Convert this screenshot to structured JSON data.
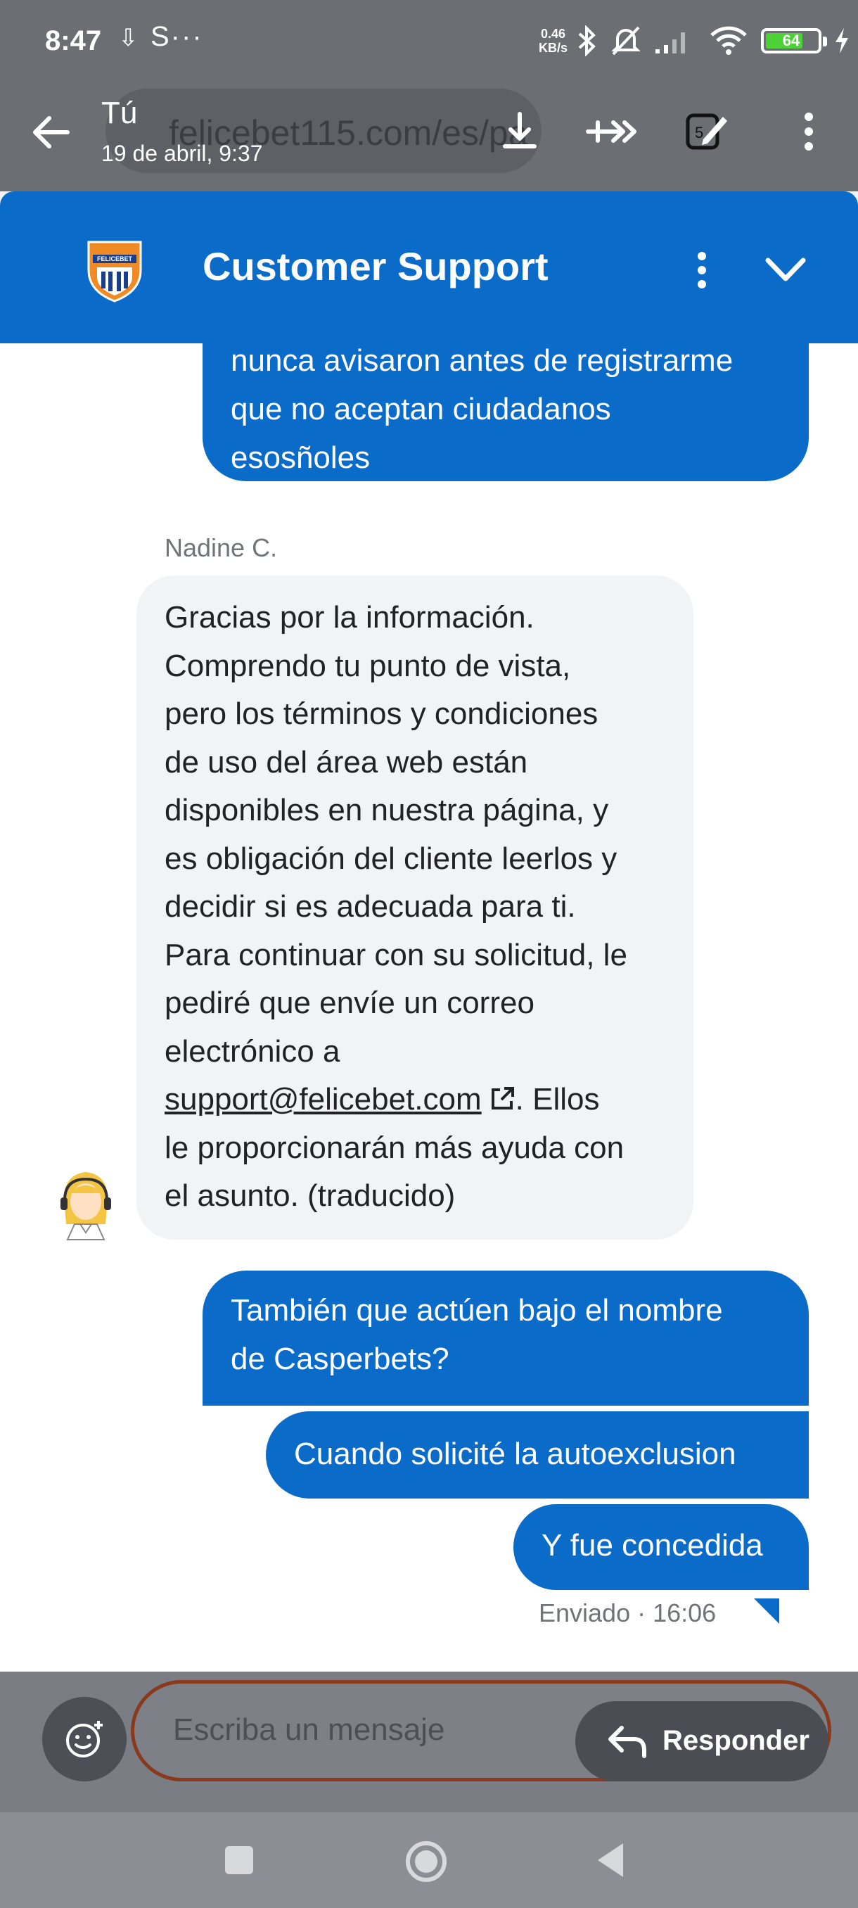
{
  "status_bar": {
    "time": "8:47",
    "overlay_text": "29 S",
    "speed_top": "0.46",
    "speed_bottom": "KB/s",
    "battery": "64"
  },
  "browser": {
    "url": "felicebet115.com/es/pa",
    "sender": "Tú",
    "sent_date": "19 de abril, 9:37",
    "tab_count": "5"
  },
  "chat": {
    "title": "Customer Support",
    "messages": [
      {
        "from": "user",
        "lines": [
          "nunca avisaron antes de registrarme",
          "que no aceptan ciudadanos",
          "esosñoles"
        ]
      },
      {
        "from": "agent",
        "agent_name": "Nadine C.",
        "lines": [
          "Gracias por la información.",
          "Comprendo tu punto de vista,",
          "pero los términos y condiciones",
          "de uso del área web están",
          "disponibles en nuestra página, y",
          "es obligación del cliente leerlos y",
          "decidir si es adecuada para ti.",
          "Para continuar con su solicitud, le",
          "pediré que envíe un correo",
          "electrónico a"
        ],
        "link": "support@felicebet.com",
        "after_link": ". Ellos",
        "tail_lines": [
          "le proporcionarán más ayuda con",
          "el asunto.  (traducido)"
        ]
      },
      {
        "from": "user",
        "lines": [
          "También que actúen bajo el nombre",
          "de Casperbets?"
        ]
      },
      {
        "from": "user",
        "lines": [
          "Cuando solicité la autoexclusion"
        ]
      },
      {
        "from": "user",
        "lines": [
          "Y fue concedida"
        ]
      }
    ],
    "sent_status": "Enviado · 16:06"
  },
  "composer": {
    "placeholder": "Escriba un mensaje",
    "reply_label": "Responder"
  },
  "colors": {
    "brand_blue": "#0a6bc9",
    "agent_bubble": "#f2f3f5",
    "overlay_gray": "#6b6e73"
  }
}
